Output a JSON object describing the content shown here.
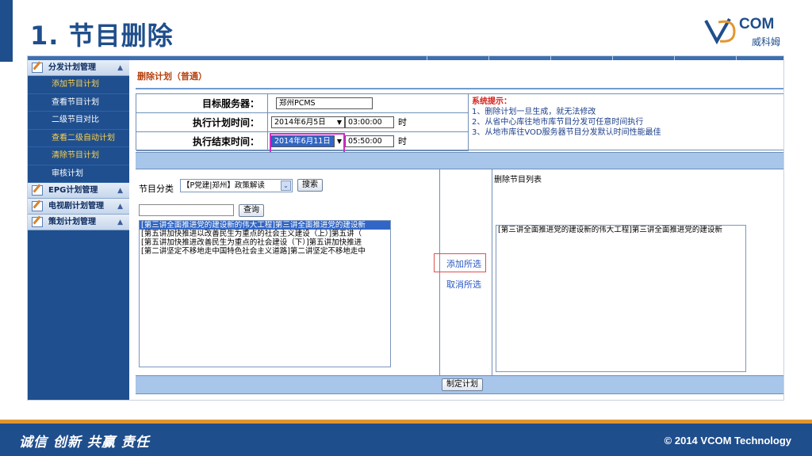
{
  "slide": {
    "title": "1. 节目删除",
    "logo_text": "COM",
    "logo_sub": "威科姆",
    "slogan": "诚信 创新 共赢  责任",
    "copyright": "© 2014 VCOM Technology"
  },
  "sidebar": {
    "groups": [
      {
        "label": "分发计划管理",
        "arrow": "▲"
      },
      {
        "label": "EPG计划管理",
        "arrow": "▲"
      },
      {
        "label": "电视剧计划管理",
        "arrow": "▲"
      },
      {
        "label": "策划计划管理",
        "arrow": "▲"
      }
    ],
    "items": [
      {
        "label": "添加节目计划"
      },
      {
        "label": "查看节目计划"
      },
      {
        "label": "二级节目对比"
      },
      {
        "label": "查看二级自动计划"
      },
      {
        "label": "清除节目计划"
      },
      {
        "label": "审核计划"
      }
    ]
  },
  "main": {
    "title": "删除计划（普通）",
    "form": {
      "server_label": "目标服务器：",
      "server_value": "郑州PCMS",
      "start_label": "执行计划时间：",
      "start_date": "2014年6月5日",
      "start_time": "03:00:00",
      "start_unit": "时",
      "end_label": "执行结束时间：",
      "end_date": "2014年6月11日",
      "end_time": "05:50:00",
      "end_unit": "时",
      "dropdown_arrow": "▼"
    },
    "hint": {
      "title": "系统提示：",
      "lines": [
        "1、删除计划一旦生成，就无法修改",
        "2、从省中心库往地市库节目分发可任意时间执行",
        "3、从地市库往VOD服务器节目分发默认时间性能最佳"
      ]
    },
    "left_panel": {
      "category_label": "节目分类",
      "category_value": "【P党建|郑州】政策解读",
      "category_arrow": "⌄",
      "search_button": "搜索",
      "query_button": "查询",
      "programs": [
        "[第三讲全面推进党的建设新的伟大工程]第三讲全面推进党的建设新",
        "[第五讲加快推进以改善民生为重点的社会主义建设（上）]第五讲（",
        "[第五讲加快推进改善民生为重点的社会建设（下）]第五讲加快推进",
        "[第二讲坚定不移地走中国特色社会主义道路]第二讲坚定不移地走中"
      ]
    },
    "middle_panel": {
      "add_selected": "添加所选",
      "cancel_selected": "取消所选"
    },
    "right_panel": {
      "title": "删除节目列表",
      "programs": [
        "[第三讲全面推进党的建设新的伟大工程]第三讲全面推进党的建设新"
      ]
    },
    "make_plan_button": "制定计划"
  }
}
